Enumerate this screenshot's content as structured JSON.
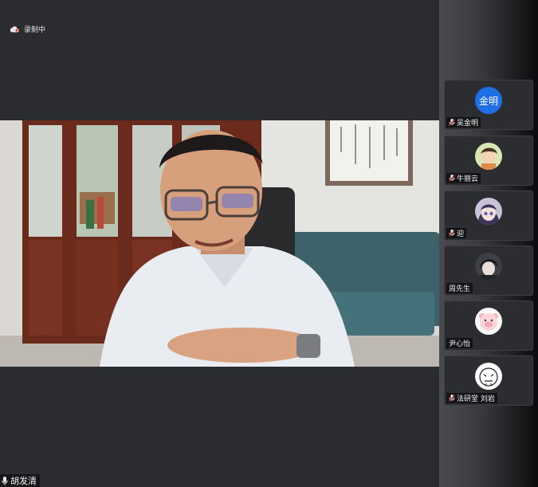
{
  "recording": {
    "label": "录制中"
  },
  "main_speaker": {
    "name": "胡发清"
  },
  "participants": [
    {
      "name": "吴金明",
      "avatar_text": "金明",
      "avatar_type": "text",
      "muted": true
    },
    {
      "name": "牛丽云",
      "avatar_type": "image",
      "muted": true
    },
    {
      "name": "迎",
      "avatar_type": "image",
      "muted": true
    },
    {
      "name": "周先生",
      "avatar_type": "image",
      "muted": false
    },
    {
      "name": "尹心怡",
      "avatar_type": "image",
      "muted": false
    },
    {
      "name": "法研堂 刘岩",
      "avatar_type": "image",
      "muted": true
    }
  ],
  "colors": {
    "accent": "#1e6fe6",
    "mute_red": "#e23b3b",
    "background": "#2a2c30"
  }
}
